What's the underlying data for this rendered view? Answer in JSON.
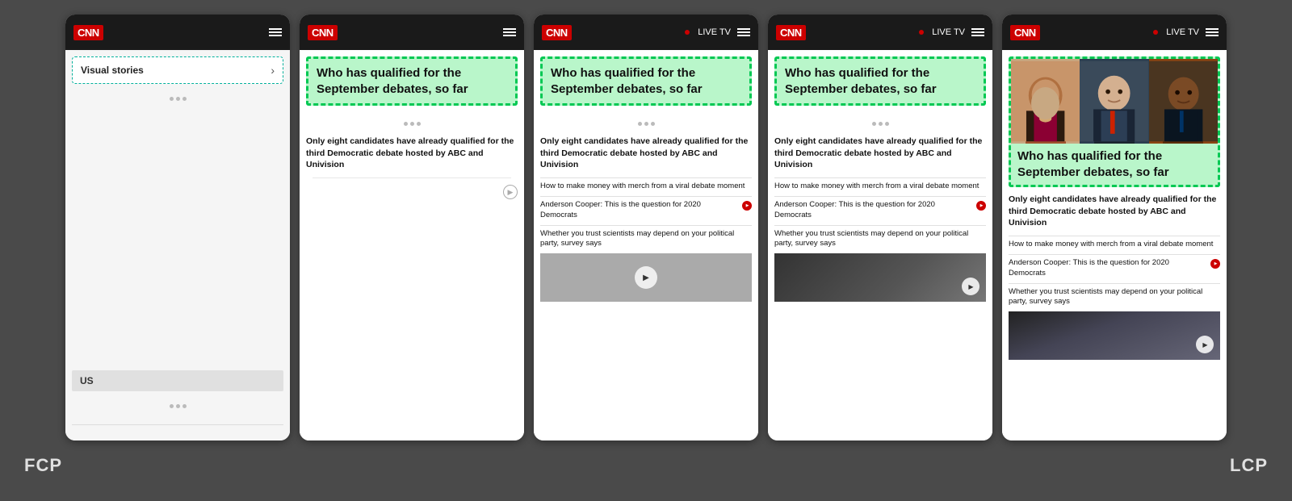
{
  "background_color": "#4a4a4a",
  "labels": {
    "fcp": "FCP",
    "lcp": "LCP"
  },
  "phones": [
    {
      "id": "phone-1",
      "type": "visual-stories",
      "header": {
        "logo": "CNN",
        "has_live_tv": false,
        "menu_icon": "☰"
      },
      "content": {
        "visual_stories_label": "Visual stories",
        "us_label": "US"
      }
    },
    {
      "id": "phone-2",
      "type": "article-no-image",
      "header": {
        "logo": "CNN",
        "has_live_tv": false,
        "menu_icon": "☰"
      },
      "content": {
        "headline": "Who has qualified for the September debates, so far",
        "main_text": "Only eight candidates have already qualified for the third Democratic debate hosted by ABC and Univision",
        "links": []
      }
    },
    {
      "id": "phone-3",
      "type": "article-with-links",
      "header": {
        "logo": "CNN",
        "has_live_tv": true,
        "live_tv_label": "LIVE TV",
        "menu_icon": "☰"
      },
      "content": {
        "headline": "Who has qualified for the September debates, so far",
        "main_text": "Only eight candidates have already qualified for the third Democratic debate hosted by ABC and Univision",
        "links": [
          "How to make money with merch from a viral debate moment",
          "Anderson Cooper: This is the question for 2020 Democrats",
          "Whether you trust scientists may depend on your political party, survey says"
        ],
        "has_video_thumb": true
      }
    },
    {
      "id": "phone-4",
      "type": "article-with-links",
      "header": {
        "logo": "CNN",
        "has_live_tv": true,
        "live_tv_label": "LIVE TV",
        "menu_icon": "☰"
      },
      "content": {
        "headline": "Who has qualified for the September debates, so far",
        "main_text": "Only eight candidates have already qualified for the third Democratic debate hosted by ABC and Univision",
        "links": [
          "How to make money with merch from a viral debate moment",
          "Anderson Cooper: This is the question for 2020 Democrats",
          "Whether you trust scientists may depend on your political party, survey says"
        ],
        "has_video_thumb": true
      }
    },
    {
      "id": "phone-5",
      "type": "article-with-image",
      "header": {
        "logo": "CNN",
        "has_live_tv": true,
        "live_tv_label": "LIVE TV",
        "menu_icon": "☰"
      },
      "content": {
        "headline": "Who has qualified for the September debates, so far",
        "main_text": "Only eight candidates have already qualified for the third Democratic debate hosted by ABC and Univision",
        "links": [
          "How to make money with merch from a viral debate moment",
          "Anderson Cooper: This is the question for 2020 Democrats",
          "Whether you trust scientists may depend on your political party, survey says"
        ],
        "has_video_thumb": true
      }
    }
  ]
}
